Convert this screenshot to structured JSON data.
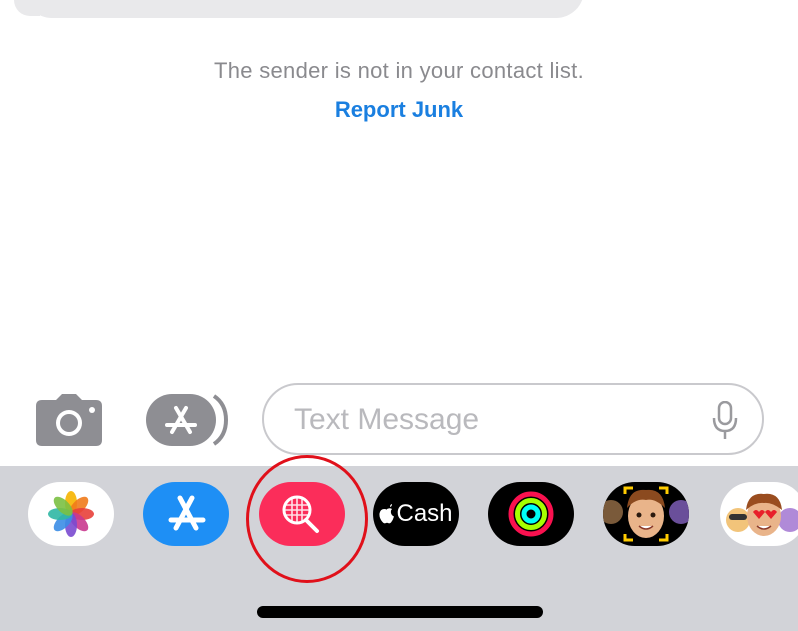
{
  "conversation": {
    "sender_note": "The sender is not in your contact list.",
    "report_junk_label": "Report Junk"
  },
  "composer": {
    "placeholder": "Text Message",
    "camera_icon": "camera-icon",
    "apps_icon": "app-store-icon",
    "mic_icon": "microphone-icon"
  },
  "app_drawer": {
    "apps": [
      {
        "name": "Photos",
        "icon": "photos-icon"
      },
      {
        "name": "App Store",
        "icon": "app-store-icon"
      },
      {
        "name": "Search Images",
        "icon": "globe-search-icon",
        "highlighted": true
      },
      {
        "name": "Apple Cash",
        "icon": "apple-logo-icon",
        "label": "Cash"
      },
      {
        "name": "Activity",
        "icon": "activity-rings-icon"
      },
      {
        "name": "Memoji",
        "icon": "memoji-icon"
      },
      {
        "name": "Memoji Stickers",
        "icon": "memoji-stickers-icon"
      }
    ]
  },
  "colors": {
    "link_blue": "#1a7fe0",
    "highlight_red": "#e0101a",
    "search_app_pink": "#fb2d5a",
    "drawer_background": "#d2d3d8"
  }
}
